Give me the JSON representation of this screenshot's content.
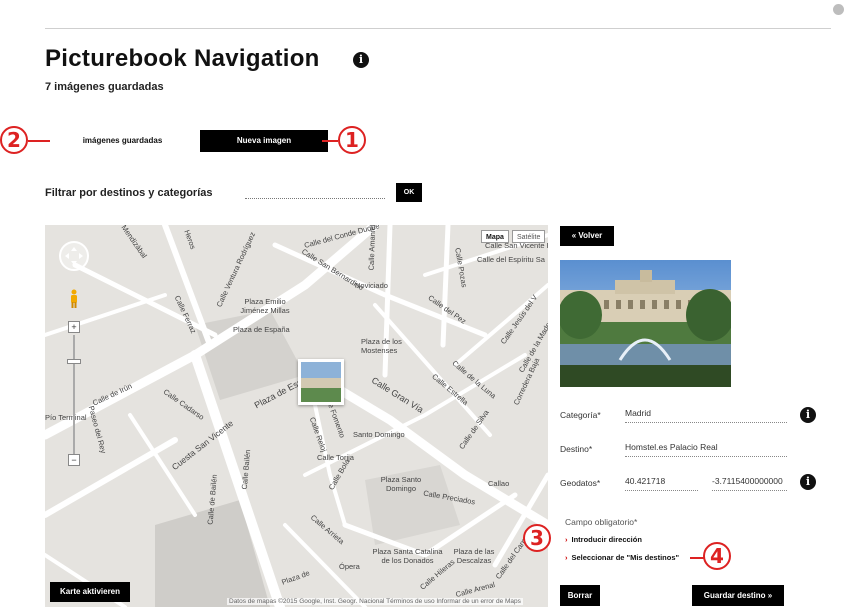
{
  "header": {
    "title": "Picturebook Navigation",
    "info_icon": "i",
    "subtitle": "7 imágenes guardadas"
  },
  "tabs": [
    {
      "label": "imágenes guardadas",
      "active": false
    },
    {
      "label": "Nueva imagen",
      "active": true
    }
  ],
  "filter": {
    "label": "Filtrar por destinos y categorías",
    "value": "",
    "button_label": "OK"
  },
  "map": {
    "types": [
      "Mapa",
      "Satélite"
    ],
    "zoom_in": "+",
    "zoom_out": "−",
    "streets": [
      "Calle del Conde Duque",
      "Mendizábal",
      "Heros",
      "Calle Ventura Rodríguez",
      "Calle San Bernardino",
      "Calle Amaniel",
      "Calle Pozas",
      "Calle del Pez",
      "Calle San Vicente F",
      "Calle del Espíritu Sa",
      "Calle Jesús del V",
      "Calle de la Madera",
      "Calle Ferraz",
      "Plaza Emilio Jiménez Millas",
      "Plaza de España",
      "Noviciado",
      "Plaza de los Mostenses",
      "Plaza de España",
      "Calle Gran Vía",
      "Calle Estrella",
      "Calle de la Luna",
      "Calle de Silva",
      "Corredera Baja",
      "Calle de Irún",
      "Calle Cadarso",
      "Cuesta San Vicente",
      "Paseo del Rey",
      "Calle Reloj",
      "Calle Fomento",
      "Santo Domingo",
      "Calle Torija",
      "Calle Bola",
      "Calle Bailén",
      "Plaza Santo Domingo",
      "Callao",
      "Calle Preciados",
      "Calle Arrieta",
      "Ópera",
      "Plaza Santa Catalina de los Donados",
      "Plaza de las Descalzas",
      "Calle del Carmen",
      "Pío Terminal",
      "Calle de Bailén",
      "Plaza de",
      "Calle Hileras",
      "Calle Arenal"
    ],
    "activate_button": "Karte aktivieren",
    "attribution": "Datos de mapas ©2015 Google, Inst. Geogr. Nacional   Términos de uso   Informar de un error de Maps"
  },
  "panel": {
    "back_button": "Volver",
    "fields": [
      {
        "label": "Categoría*",
        "value": "Madrid"
      },
      {
        "label": "Destino*",
        "value": "Homstel.es Palacio Real"
      },
      {
        "label": "Geodatos*",
        "lat": "40.421718",
        "lng": "-3.7115400000000"
      }
    ],
    "required_note": "Campo obligatorio*",
    "links": [
      "Introducir dirección",
      "Seleccionar de \"Mis destinos\""
    ],
    "delete_button": "Borrar",
    "save_button": "Guardar destino"
  },
  "callouts": [
    "1",
    "2",
    "3",
    "4"
  ],
  "colors": {
    "callout": "#dd2222",
    "button_bg": "#000000",
    "map_bg": "#e5e3df",
    "link_chevron": "#cc0000"
  }
}
